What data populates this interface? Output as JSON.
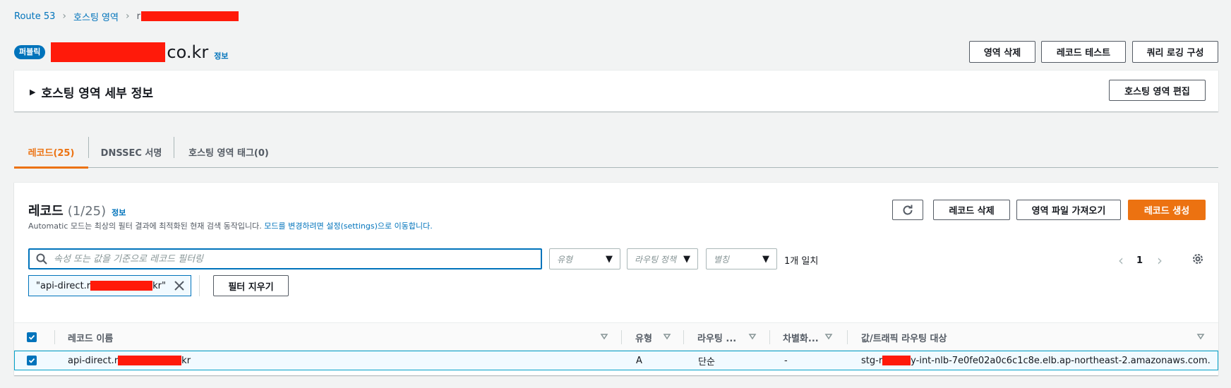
{
  "breadcrumb": {
    "root": "Route 53",
    "hosted_zones": "호스팅 영역",
    "current_prefix": "r"
  },
  "header": {
    "badge": "퍼블릭",
    "zone_suffix": "co.kr",
    "info": "정보",
    "delete_zone": "영역 삭제",
    "test_record": "레코드 테스트",
    "query_logging": "쿼리 로깅 구성"
  },
  "details": {
    "title": "호스팅 영역 세부 정보",
    "edit_button": "호스팅 영역 편집"
  },
  "tabs": [
    {
      "label": "레코드(25)",
      "active": true
    },
    {
      "label": "DNSSEC 서명",
      "active": false
    },
    {
      "label": "호스팅 영역 태그(0)",
      "active": false
    }
  ],
  "records": {
    "title": "레코드",
    "count": "(1/25)",
    "info": "정보",
    "desc_text": "Automatic 모드는 최상의 필터 결과에 최적화된 현재 검색 동작입니다.",
    "desc_link": "모드를 변경하려면 설정(settings)으로 이동합니다.",
    "delete_button": "레코드 삭제",
    "import_button": "영역 파일 가져오기",
    "create_button": "레코드 생성",
    "search_placeholder": "속성 또는 값을 기준으로 레코드 필터링",
    "filter_type": "유형",
    "filter_routing": "라우팅 정책",
    "filter_alias": "별칭",
    "match_text": "1개 일치",
    "page_number": "1",
    "token_prefix": "\"api-direct.r",
    "token_suffix": "kr\"",
    "clear_filters": "필터 지우기"
  },
  "table": {
    "columns": [
      "레코드 이름",
      "유형",
      "라우팅 ...",
      "차별화...",
      "값/트래픽 라우팅 대상"
    ],
    "row": {
      "name_prefix": "api-direct.r",
      "name_suffix": "kr",
      "type": "A",
      "routing": "단순",
      "differentiator": "-",
      "value_prefix": "stg-r",
      "value_suffix": "y-int-nlb-7e0fe02a0c6c1c8e.elb.ap-northeast-2.amazonaws.com."
    }
  },
  "colors": {
    "primary": "#ec7211",
    "link": "#0073bb",
    "redaction": "#ff1a0a"
  }
}
